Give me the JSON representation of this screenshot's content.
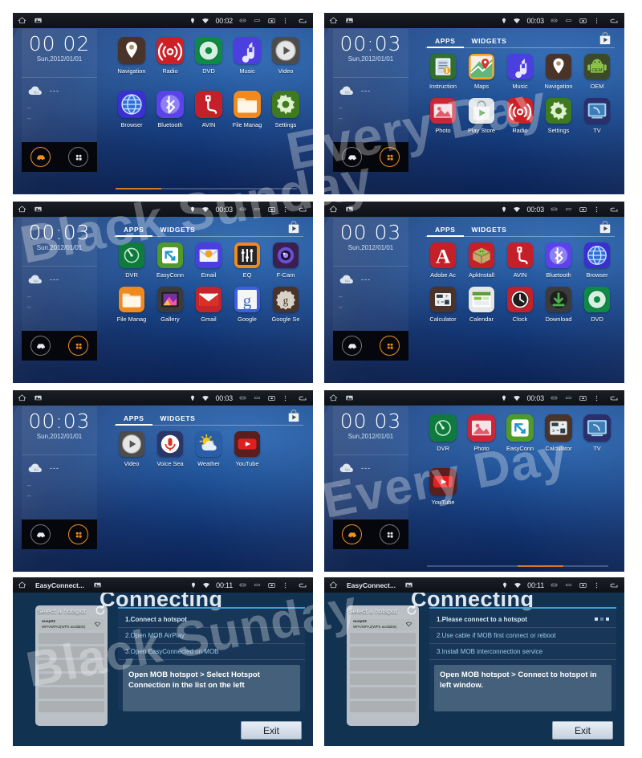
{
  "watermark": {
    "line1": "Black Sunday",
    "line2": "Every Day",
    "line3": "Black Sunday",
    "line4": "Every Day"
  },
  "statusbar": {
    "clock_00_02": "00:02",
    "clock_00_03": "00:03",
    "clock_00_11": "00:11",
    "app_title": "EasyConnect...",
    "icons": [
      "home-icon",
      "screenshot-icon",
      "location-icon",
      "wifi-icon",
      "link-icon",
      "usb-icon",
      "picture-in-picture-icon",
      "overflow-menu-icon",
      "back-icon"
    ]
  },
  "widget": {
    "time_home": "00  02",
    "time_apps": "00:03",
    "time_apps_spaced": "00  03",
    "date": "Sun,2012/01/01",
    "weather_badge": "NA",
    "weather_temp": "---",
    "weather_line1": "--",
    "weather_line2": "--",
    "dock_car": "car-mode-icon",
    "dock_apps": "all-apps-icon"
  },
  "tabs": {
    "apps": "APPS",
    "widgets": "WIDGETS",
    "playstore": "play-store-icon"
  },
  "panels": [
    {
      "id": "panel-home",
      "kind": "home",
      "clock": "00  02",
      "clock_style": "spaced",
      "status_time": "00:02",
      "has_tabs": false,
      "page_indicator": {
        "segments": 4,
        "active": 0
      },
      "apps": [
        {
          "label": "Navigation",
          "icon": "navigation-pin-icon",
          "bg": "#4a3328",
          "fg": "#ffffff"
        },
        {
          "label": "Radio",
          "icon": "radio-waves-icon",
          "bg": "#cc2026",
          "fg": "#ffffff"
        },
        {
          "label": "DVD",
          "icon": "disc-icon",
          "bg": "#0f8a46",
          "fg": "#ffffff"
        },
        {
          "label": "Music",
          "icon": "music-note-icon",
          "bg": "#4b3fe0",
          "fg": "#ffffff"
        },
        {
          "label": "Video",
          "icon": "play-circle-icon",
          "bg": "#4c4c4c",
          "fg": "#ffffff"
        },
        {
          "label": "Browser",
          "icon": "globe-icon",
          "bg": "#3a2fd0",
          "fg": "#ffffff"
        },
        {
          "label": "Bluetooth",
          "icon": "bluetooth-icon",
          "bg": "#5a43e8",
          "fg": "#ffffff"
        },
        {
          "label": "AVIN",
          "icon": "avin-plug-icon",
          "bg": "#c3202a",
          "fg": "#ffffff"
        },
        {
          "label": "File Manag",
          "icon": "folder-icon",
          "bg": "#f08a1e",
          "fg": "#ffffff"
        },
        {
          "label": "Settings",
          "icon": "gear-icon",
          "bg": "#3f7a1f",
          "fg": "#ffffff"
        }
      ]
    },
    {
      "id": "panel-apps-1",
      "kind": "apps",
      "clock": "00:03",
      "clock_style": "colon",
      "status_time": "00:03",
      "has_tabs": true,
      "page_indicator": null,
      "apps": [
        {
          "label": "Instruction",
          "icon": "instruction-doc-icon",
          "bg": "#2f6f2f",
          "fg": "#ffffff"
        },
        {
          "label": "Maps",
          "icon": "maps-pin-icon",
          "bg": "#f5a31e",
          "fg": "#ffffff"
        },
        {
          "label": "Music",
          "icon": "music-note-icon",
          "bg": "#4b3fe0",
          "fg": "#ffffff"
        },
        {
          "label": "Navigation",
          "icon": "navigation-pin-icon",
          "bg": "#4a3328",
          "fg": "#ffffff"
        },
        {
          "label": "OEM",
          "icon": "android-oem-icon",
          "bg": "#3d4a2a",
          "fg": "#ffffff"
        },
        {
          "label": "Photo",
          "icon": "photo-icon",
          "bg": "#c9263a",
          "fg": "#ffffff"
        },
        {
          "label": "Play Store",
          "icon": "play-store-bag-icon",
          "bg": "#dfe3e6",
          "fg": "#333333"
        },
        {
          "label": "Radio",
          "icon": "radio-waves-icon",
          "bg": "#cc2026",
          "fg": "#ffffff"
        },
        {
          "label": "Settings",
          "icon": "gear-icon",
          "bg": "#3f7a1f",
          "fg": "#ffffff"
        },
        {
          "label": "TV",
          "icon": "tv-icon",
          "bg": "#2b2f6b",
          "fg": "#ffffff"
        }
      ]
    },
    {
      "id": "panel-apps-2",
      "kind": "apps",
      "clock": "00:03",
      "clock_style": "colon",
      "status_time": "00:03",
      "has_tabs": true,
      "page_indicator": null,
      "apps": [
        {
          "label": "DVR",
          "icon": "dvr-gauge-icon",
          "bg": "#0f7a3d",
          "fg": "#ffffff"
        },
        {
          "label": "EasyConn",
          "icon": "easyconnected-icon",
          "bg": "#4f9a2a",
          "fg": "#ffffff"
        },
        {
          "label": "Email",
          "icon": "email-envelope-icon",
          "bg": "#4b3fe0",
          "fg": "#ffffff"
        },
        {
          "label": "EQ",
          "icon": "equalizer-icon",
          "bg": "#f08a1e",
          "fg": "#ffffff"
        },
        {
          "label": "F-Cam",
          "icon": "front-camera-icon",
          "bg": "#3a2050",
          "fg": "#ffffff"
        },
        {
          "label": "File Manag",
          "icon": "folder-icon",
          "bg": "#f08a1e",
          "fg": "#ffffff"
        },
        {
          "label": "Gallery",
          "icon": "gallery-icon",
          "bg": "#3b3b3b",
          "fg": "#ffffff"
        },
        {
          "label": "Gmail",
          "icon": "gmail-icon",
          "bg": "#c5242c",
          "fg": "#ffffff"
        },
        {
          "label": "Google",
          "icon": "google-g-icon",
          "bg": "#3f5fe0",
          "fg": "#ffffff"
        },
        {
          "label": "Google Se",
          "icon": "google-settings-icon",
          "bg": "#4a3328",
          "fg": "#ffffff"
        }
      ]
    },
    {
      "id": "panel-apps-3",
      "kind": "apps",
      "clock": "00  03",
      "clock_style": "spaced",
      "status_time": "00:03",
      "has_tabs": true,
      "page_indicator": null,
      "apps": [
        {
          "label": "Adobe Ac",
          "icon": "adobe-acrobat-icon",
          "bg": "#c3202a",
          "fg": "#ffffff"
        },
        {
          "label": "ApkInstall",
          "icon": "apk-installer-icon",
          "bg": "#c3202a",
          "fg": "#ffffff"
        },
        {
          "label": "AVIN",
          "icon": "avin-plug-icon",
          "bg": "#c3202a",
          "fg": "#ffffff"
        },
        {
          "label": "Bluetooth",
          "icon": "bluetooth-icon",
          "bg": "#5a43e8",
          "fg": "#ffffff"
        },
        {
          "label": "Browser",
          "icon": "globe-icon",
          "bg": "#3a2fd0",
          "fg": "#ffffff"
        },
        {
          "label": "Calculator",
          "icon": "calculator-icon",
          "bg": "#4a3328",
          "fg": "#ffffff"
        },
        {
          "label": "Calendar",
          "icon": "calendar-icon",
          "bg": "#e6e6e6",
          "fg": "#333333"
        },
        {
          "label": "Clock",
          "icon": "clock-icon",
          "bg": "#c3202a",
          "fg": "#ffffff"
        },
        {
          "label": "Download",
          "icon": "download-icon",
          "bg": "#3b3b3b",
          "fg": "#ffffff"
        },
        {
          "label": "DVD",
          "icon": "disc-icon",
          "bg": "#0f8a46",
          "fg": "#ffffff"
        }
      ]
    },
    {
      "id": "panel-apps-4",
      "kind": "apps",
      "clock": "00:03",
      "clock_style": "colon",
      "status_time": "00:03",
      "has_tabs": true,
      "page_indicator": null,
      "apps": [
        {
          "label": "Video",
          "icon": "play-circle-icon",
          "bg": "#4c4c4c",
          "fg": "#ffffff"
        },
        {
          "label": "Voice Sea",
          "icon": "microphone-icon",
          "bg": "#2b3668",
          "fg": "#ffffff"
        },
        {
          "label": "Weather",
          "icon": "weather-sun-cloud-icon",
          "bg": "#2a5fa8",
          "fg": "#ffffff"
        },
        {
          "label": "YouTube",
          "icon": "youtube-icon",
          "bg": "#5a1e1e",
          "fg": "#ffffff"
        }
      ]
    },
    {
      "id": "panel-home-2",
      "kind": "home",
      "clock": "00  03",
      "clock_style": "spaced",
      "status_time": "00:03",
      "has_tabs": false,
      "page_indicator": {
        "segments": 4,
        "active": 2
      },
      "apps": [
        {
          "label": "DVR",
          "icon": "dvr-gauge-icon",
          "bg": "#0f7a3d",
          "fg": "#ffffff"
        },
        {
          "label": "Photo",
          "icon": "photo-icon",
          "bg": "#c9263a",
          "fg": "#ffffff"
        },
        {
          "label": "EasyConn",
          "icon": "easyconnected-icon",
          "bg": "#4f9a2a",
          "fg": "#ffffff"
        },
        {
          "label": "Calculator",
          "icon": "calculator-icon",
          "bg": "#4a3328",
          "fg": "#ffffff"
        },
        {
          "label": "TV",
          "icon": "tv-icon",
          "bg": "#2b2f6b",
          "fg": "#ffffff"
        },
        {
          "label": "YouTube",
          "icon": "youtube-icon",
          "bg": "#5a1e1e",
          "fg": "#ffffff"
        }
      ]
    }
  ],
  "easyconnect": [
    {
      "id": "panel-easyconnect-1",
      "title": "Connecting",
      "status_time": "00:11",
      "app_title": "EasyConnect...",
      "hotspot_header": "Select a hotspot",
      "ssid": "ousp03",
      "ssid_sub": "WPA/WPA2(WPS available)",
      "rows": 7,
      "steps": [
        "1.Connect a hotspot",
        "2.Open MOB AirPlay",
        "3.Open EasyConnected on MOB"
      ],
      "show_dots": false,
      "hint": "Open MOB hotspot > Select Hotspot Connection in the list on the left",
      "exit": "Exit"
    },
    {
      "id": "panel-easyconnect-2",
      "title": "Connecting",
      "status_time": "00:11",
      "app_title": "EasyConnect...",
      "hotspot_header": "Select a hotspot",
      "ssid": "ousp03",
      "ssid_sub": "WPA/WPA2(WPS available)",
      "rows": 7,
      "steps": [
        "1.Please connect to a hotspot",
        "2.Use cable if MOB first connect or reboot",
        "3.Install MOB interconnection service"
      ],
      "show_dots": true,
      "hint": "Open MOB hotspot > Connect to hotspot in left window.",
      "exit": "Exit"
    }
  ],
  "colors": {
    "accent_orange": "#f0901c",
    "page_active": "#d8762a",
    "ec_bg": "#123252",
    "ec_rule": "#3aa0e0",
    "statusbar_bg": "#0e1116"
  }
}
